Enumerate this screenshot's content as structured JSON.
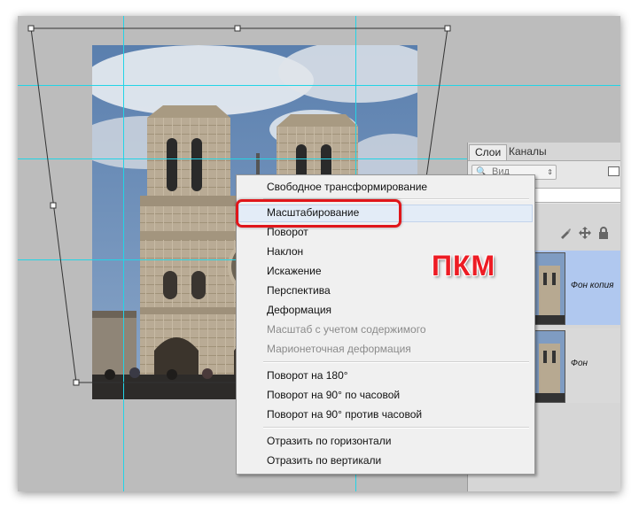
{
  "layers_panel": {
    "tabs": [
      {
        "label": "Слои",
        "active": true
      },
      {
        "label": "Каналы",
        "active": false
      }
    ],
    "filter": {
      "search_icon": "🔍",
      "kind_label": "Вид",
      "arrows": "⇕"
    },
    "lock_icons": [
      "lock-pixels-brush-icon",
      "lock-position-move-icon",
      "lock-all-icon"
    ],
    "layers": [
      {
        "name": "Фон копия",
        "selected": true
      },
      {
        "name": "Фон",
        "selected": false
      }
    ]
  },
  "context_menu": {
    "groups": [
      [
        {
          "label": "Свободное трансформирование",
          "enabled": true
        },
        {
          "label": "Масштабирование",
          "enabled": true,
          "hovered": true
        },
        {
          "label": "Поворот",
          "enabled": true
        },
        {
          "label": "Наклон",
          "enabled": true
        },
        {
          "label": "Искажение",
          "enabled": true
        },
        {
          "label": "Перспектива",
          "enabled": true
        },
        {
          "label": "Деформация",
          "enabled": true
        },
        {
          "label": "Масштаб с учетом содержимого",
          "enabled": false
        },
        {
          "label": "Марионеточная деформация",
          "enabled": false
        }
      ],
      [
        {
          "label": "Поворот на 180°",
          "enabled": true
        },
        {
          "label": "Поворот на 90° по часовой",
          "enabled": true
        },
        {
          "label": "Поворот на 90° против часовой",
          "enabled": true
        }
      ],
      [
        {
          "label": "Отразить по горизонтали",
          "enabled": true
        },
        {
          "label": "Отразить по вертикали",
          "enabled": true
        }
      ]
    ]
  },
  "annotation": {
    "label": "ПКМ",
    "color": "#ed1c24"
  },
  "colors": {
    "guide": "#22d4e6",
    "canvas_bg": "#bcbcbc",
    "selected_layer": "#b0c8ef"
  }
}
